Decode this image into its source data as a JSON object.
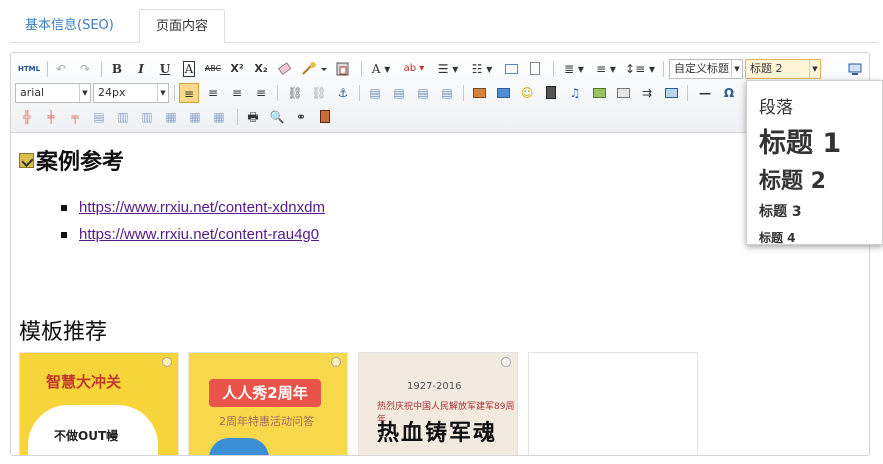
{
  "tabs": [
    {
      "label": "基本信息(SEO)",
      "active": false
    },
    {
      "label": "页面内容",
      "active": true
    }
  ],
  "toolbar": {
    "html_label": "HTML",
    "bold": "B",
    "italic": "I",
    "underline": "U",
    "font_border": "A",
    "strikethrough": "ABC",
    "superscript": "X²",
    "subscript": "X₂",
    "font_color": "A",
    "custom_title_select": "自定义标题",
    "paragraph_select": "标题 2",
    "font_family_select": "arial",
    "font_size_select": "24px",
    "omega": "Ω",
    "hr": "—"
  },
  "format_panel": {
    "options": [
      "段落",
      "标题 1",
      "标题 2",
      "标题 3",
      "标题 4"
    ]
  },
  "content": {
    "case_heading": "案例参考",
    "links": [
      "https://www.rrxiu.net/content-xdnxdm",
      "https://www.rrxiu.net/content-rau4g0"
    ],
    "template_heading": "模板推荐",
    "cards": [
      {
        "title": "智慧大冲关",
        "subtitle": "不做OUT幔"
      },
      {
        "title": "人人秀2周年",
        "subtitle": "2周年特惠活动问答"
      },
      {
        "title": "1927-2016",
        "subtitle": "热烈庆祝中国人民解放军建军89周年",
        "calligraphy": "热血铸军魂"
      },
      {
        "title": "",
        "subtitle": ""
      }
    ]
  },
  "colors": {
    "tab_link": "#3a7fc1",
    "link_visited": "#551a8b",
    "active_select": "#fff6d8"
  }
}
